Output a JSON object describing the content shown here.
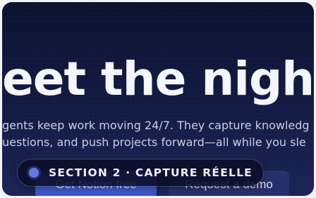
{
  "hero": {
    "headline": "eet the night sh",
    "subtitle_line1": "gents keep work moving 24/7. They capture knowledg",
    "subtitle_line2": "uestions, and push projects forward—all while you sle"
  },
  "buttons": {
    "primary_label": "Get Notion free",
    "secondary_label": "Request a demo"
  },
  "badge": {
    "label": "SECTION 2 · CAPTURE RÉELLE"
  },
  "colors": {
    "background": "#141b44",
    "primary_button": "#3e56c9",
    "secondary_button": "#27306a",
    "badge_dot": "#5f79e8"
  }
}
